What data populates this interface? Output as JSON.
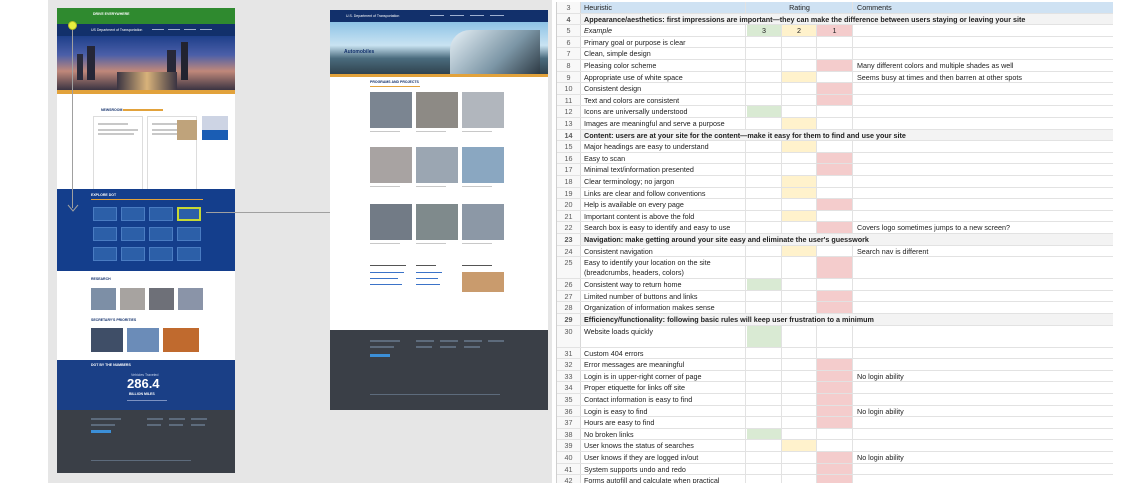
{
  "home_page": {
    "brand": "DRIVE EVERYWHERE",
    "agency": "US Department of Transportation",
    "newsroom_title": "NEWSROOM",
    "explore_title": "EXPLORE DOT",
    "research_title": "RESEARCH",
    "secretary_title": "SECRETARY'S PRIORITIES",
    "stats_title": "DOT BY THE NUMBERS",
    "stats_label": "Vehicles Traveled",
    "stats_value": "286.4",
    "stats_unit": "BILLION MILES"
  },
  "auto_page": {
    "agency": "U.S. Department of Transportation",
    "hero_title": "Automobiles",
    "programs_title": "PROGRAMS AND PROJECTS"
  },
  "sheet": {
    "header": {
      "num": "3",
      "heuristic": "Heuristic",
      "rating": "Rating",
      "comments": "Comments"
    },
    "rows": [
      {
        "num": "4",
        "type": "section",
        "heuristic": "Appearance/aesthetics: first impressions are important—they can make the difference between users staying or leaving your site"
      },
      {
        "num": "5",
        "type": "example",
        "heuristic": "Example",
        "r1": "3",
        "r2": "2",
        "r3": "1",
        "fill": [
          "green",
          "yellow",
          "red"
        ]
      },
      {
        "num": "6",
        "heuristic": "Primary goal or purpose is clear"
      },
      {
        "num": "7",
        "heuristic": "Clean, simple design"
      },
      {
        "num": "8",
        "heuristic": "Pleasing color scheme",
        "fill": [
          "",
          "",
          "red"
        ],
        "comment": "Many different colors and multiple shades as well"
      },
      {
        "num": "9",
        "heuristic": "Appropriate use of white space",
        "fill": [
          "",
          "yellow",
          ""
        ],
        "comment": "Seems busy at times and then barren at other spots"
      },
      {
        "num": "10",
        "heuristic": "Consistent design",
        "fill": [
          "",
          "",
          "red"
        ]
      },
      {
        "num": "11",
        "heuristic": "Text and colors are consistent",
        "fill": [
          "",
          "",
          "red"
        ]
      },
      {
        "num": "12",
        "heuristic": "Icons are universally understood",
        "fill": [
          "green",
          "",
          ""
        ]
      },
      {
        "num": "13",
        "heuristic": "Images are meaningful and serve a purpose",
        "fill": [
          "",
          "yellow",
          ""
        ]
      },
      {
        "num": "14",
        "type": "section",
        "heuristic": "Content: users are at your site for the content—make it easy for them to find and use your site"
      },
      {
        "num": "15",
        "heuristic": "Major headings are easy to understand",
        "fill": [
          "",
          "yellow",
          ""
        ]
      },
      {
        "num": "16",
        "heuristic": "Easy to scan",
        "fill": [
          "",
          "",
          "red"
        ]
      },
      {
        "num": "17",
        "heuristic": "Minimal text/information presented",
        "fill": [
          "",
          "",
          "red"
        ]
      },
      {
        "num": "18",
        "heuristic": "Clear terminology; no jargon",
        "fill": [
          "",
          "yellow",
          ""
        ]
      },
      {
        "num": "19",
        "heuristic": "Links are clear and follow conventions",
        "fill": [
          "",
          "yellow",
          ""
        ]
      },
      {
        "num": "20",
        "heuristic": "Help is available on every page",
        "fill": [
          "",
          "",
          "red"
        ]
      },
      {
        "num": "21",
        "heuristic": "Important content is above the fold",
        "fill": [
          "",
          "yellow",
          ""
        ]
      },
      {
        "num": "22",
        "heuristic": "Search box is easy to identify and easy to use",
        "fill": [
          "",
          "",
          "red"
        ],
        "comment": "Covers logo sometimes jumps to a new screen?"
      },
      {
        "num": "23",
        "type": "section",
        "heuristic": "Navigation: make getting around your site easy and eliminate the user's guesswork"
      },
      {
        "num": "24",
        "heuristic": "Consistent navigation",
        "fill": [
          "",
          "yellow",
          ""
        ],
        "comment": "Search nav is different"
      },
      {
        "num": "25",
        "type": "tall",
        "heuristic": "Easy to identify your location on the site",
        "heuristic2": "(breadcrumbs, headers, colors)",
        "fill": [
          "",
          "",
          "red"
        ]
      },
      {
        "num": "26",
        "heuristic": "Consistent way to return home",
        "fill": [
          "green",
          "",
          ""
        ]
      },
      {
        "num": "27",
        "heuristic": "Limited number of buttons and links",
        "fill": [
          "",
          "",
          "red"
        ]
      },
      {
        "num": "28",
        "heuristic": "Organization of information makes sense",
        "fill": [
          "",
          "",
          "red"
        ]
      },
      {
        "num": "29",
        "type": "section",
        "heuristic": "Efficiency/functionality: following basic rules will keep user frustration to a minimum"
      },
      {
        "num": "30",
        "type": "tall",
        "heuristic": "Website loads quickly",
        "heuristic2": "",
        "fill": [
          "green",
          "",
          ""
        ]
      },
      {
        "num": "31",
        "heuristic": "Custom 404 errors"
      },
      {
        "num": "32",
        "heuristic": "Error messages are meaningful",
        "fill": [
          "",
          "",
          "red"
        ]
      },
      {
        "num": "33",
        "heuristic": "Login is in upper-right corner of page",
        "fill": [
          "",
          "",
          "red"
        ],
        "comment": "No login ability"
      },
      {
        "num": "34",
        "heuristic": "Proper etiquette for links off site",
        "fill": [
          "",
          "",
          "red"
        ]
      },
      {
        "num": "35",
        "heuristic": "Contact information is easy to find",
        "fill": [
          "",
          "",
          "red"
        ]
      },
      {
        "num": "36",
        "heuristic": "Login is easy to find",
        "fill": [
          "",
          "",
          "red"
        ],
        "comment": "No login ability"
      },
      {
        "num": "37",
        "heuristic": "Hours are easy to find",
        "fill": [
          "",
          "",
          "red"
        ]
      },
      {
        "num": "38",
        "heuristic": "No broken links",
        "fill": [
          "green",
          "",
          ""
        ]
      },
      {
        "num": "39",
        "heuristic": "User knows the status of searches",
        "fill": [
          "",
          "yellow",
          ""
        ]
      },
      {
        "num": "40",
        "heuristic": "User knows if they are logged in/out",
        "fill": [
          "",
          "",
          "red"
        ],
        "comment": "No login ability"
      },
      {
        "num": "41",
        "heuristic": "System supports undo and redo",
        "fill": [
          "",
          "",
          "red"
        ]
      },
      {
        "num": "42",
        "heuristic": "Forms autofill and calculate when practical",
        "fill": [
          "",
          "",
          "red"
        ]
      }
    ]
  }
}
